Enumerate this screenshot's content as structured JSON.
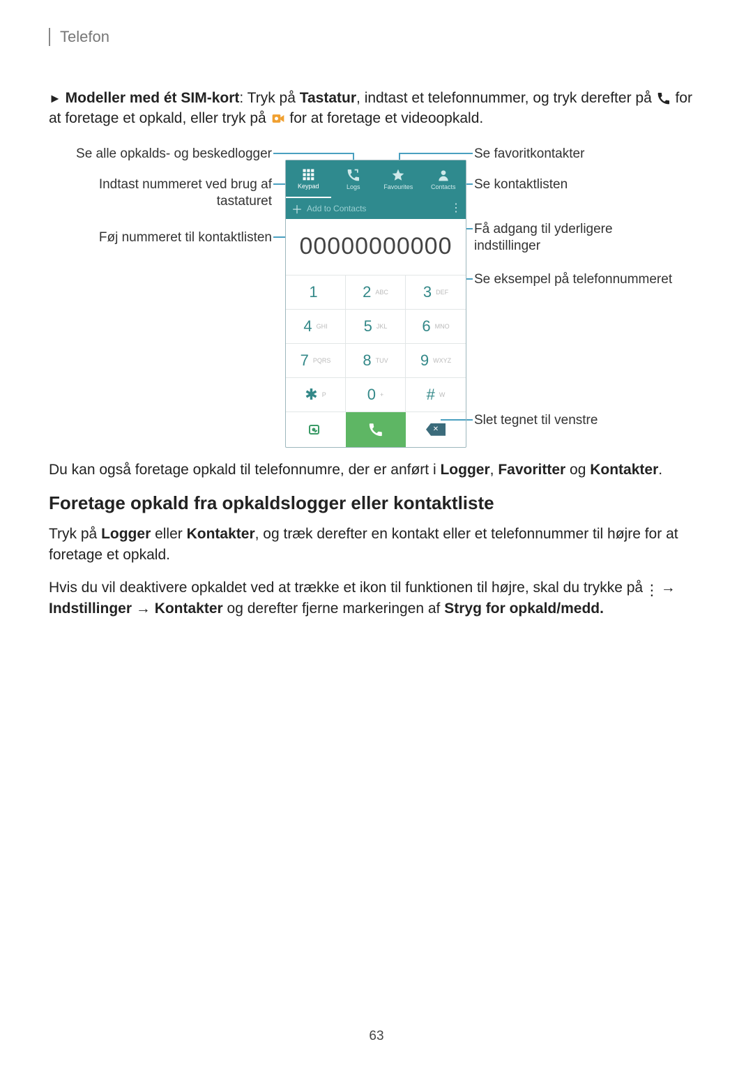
{
  "header": {
    "section": "Telefon"
  },
  "paragraph1": {
    "tri": "►",
    "bold1": "Modeller med ét SIM-kort",
    "text1": ": Tryk på ",
    "bold2": "Tastatur",
    "text2": ", indtast et telefonnummer, og tryk derefter på ",
    "text3": " for at foretage et opkald, eller tryk på ",
    "text4": " for at foretage et videoopkald."
  },
  "callouts": {
    "left1": "Se alle opkalds- og beskedlogger",
    "left2": "Indtast nummeret ved brug af tastaturet",
    "left3": "Føj nummeret til kontaktlisten",
    "right1": "Se favoritkontakter",
    "right2": "Se kontaktlisten",
    "right3_a": "Få adgang til yderligere",
    "right3_b": "indstillinger",
    "right4": "Se eksempel på telefonnummeret",
    "right5": "Slet tegnet til venstre"
  },
  "phone": {
    "tabs": [
      "Keypad",
      "Logs",
      "Favourites",
      "Contacts"
    ],
    "add_to_contacts": "Add to Contacts",
    "display_number": "00000000000",
    "keys": [
      {
        "d": "1",
        "s": " "
      },
      {
        "d": "2",
        "s": "ABC"
      },
      {
        "d": "3",
        "s": "DEF"
      },
      {
        "d": "4",
        "s": "GHI"
      },
      {
        "d": "5",
        "s": "JKL"
      },
      {
        "d": "6",
        "s": "MNO"
      },
      {
        "d": "7",
        "s": "PQRS"
      },
      {
        "d": "8",
        "s": "TUV"
      },
      {
        "d": "9",
        "s": "WXYZ"
      },
      {
        "d": "✱",
        "s": "P"
      },
      {
        "d": "0",
        "s": "+"
      },
      {
        "d": "#",
        "s": "W"
      }
    ]
  },
  "paragraph2": {
    "pre": "Du kan også foretage opkald til telefonnumre, der er anført i ",
    "b1": "Logger",
    "c1": ", ",
    "b2": "Favoritter",
    "c2": " og ",
    "b3": "Kontakter",
    "c3": "."
  },
  "section_heading": "Foretage opkald fra opkaldslogger eller kontaktliste",
  "paragraph3": {
    "pre": "Tryk på ",
    "b1": "Logger",
    "c1": " eller ",
    "b2": "Kontakter",
    "post": ", og træk derefter en kontakt eller et telefonnummer til højre for at foretage et opkald."
  },
  "paragraph4": {
    "line1_pre": "Hvis du vil deaktivere opkaldet ved at trække et ikon til funktionen til højre, skal du trykke på ",
    "arrow1": " → ",
    "b1": "Indstillinger",
    "arrow2": " → ",
    "b2": "Kontakter",
    "mid": " og derefter fjerne markeringen af ",
    "b3": "Stryg for opkald/medd."
  },
  "page_number": "63"
}
